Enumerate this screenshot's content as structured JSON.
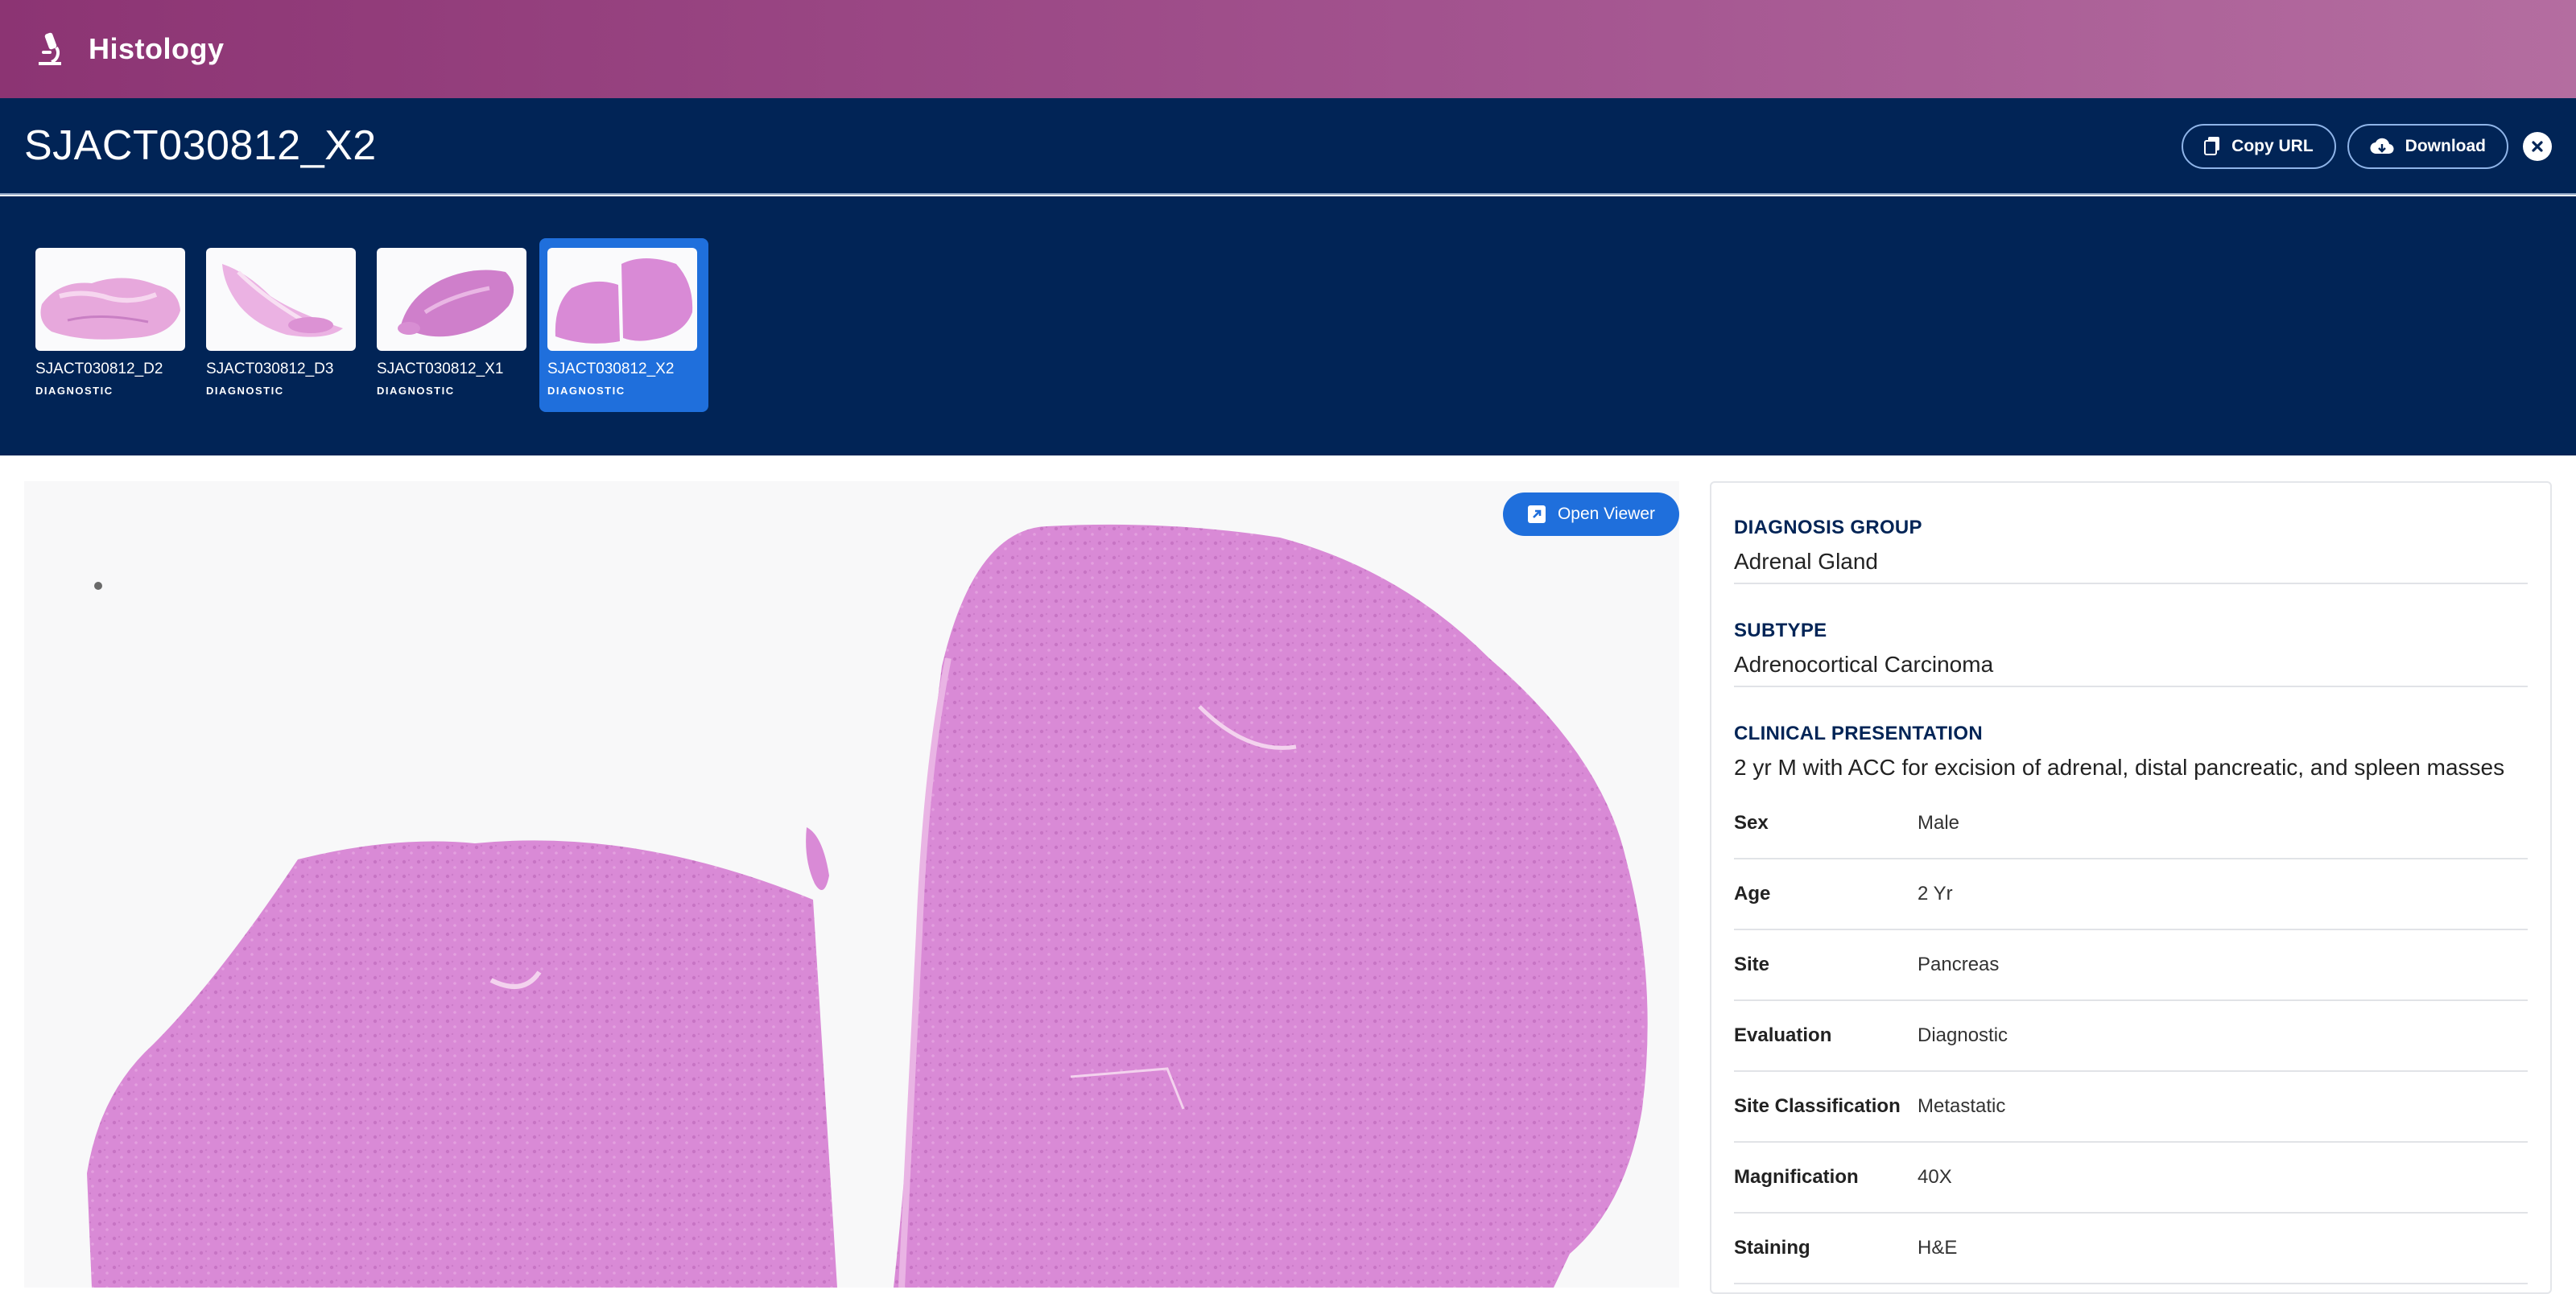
{
  "app": {
    "title": "Histology",
    "icon": "microscope-icon"
  },
  "slide": {
    "title": "SJACT030812_X2",
    "actions": {
      "copy_url": "Copy URL",
      "download": "Download"
    }
  },
  "thumbnails": [
    {
      "name": "SJACT030812_D2",
      "tag": "DIAGNOSTIC",
      "selected": false
    },
    {
      "name": "SJACT030812_D3",
      "tag": "DIAGNOSTIC",
      "selected": false
    },
    {
      "name": "SJACT030812_X1",
      "tag": "DIAGNOSTIC",
      "selected": false
    },
    {
      "name": "SJACT030812_X2",
      "tag": "DIAGNOSTIC",
      "selected": true
    }
  ],
  "viewer": {
    "open_label": "Open Viewer"
  },
  "details": {
    "diagnosis_group": {
      "label": "DIAGNOSIS GROUP",
      "value": "Adrenal Gland"
    },
    "subtype": {
      "label": "SUBTYPE",
      "value": "Adrenocortical Carcinoma"
    },
    "clinical": {
      "label": "CLINICAL PRESENTATION",
      "value": "2 yr M with ACC for excision of adrenal, distal pancreatic, and spleen masses"
    },
    "fields": [
      {
        "key": "Sex",
        "value": "Male"
      },
      {
        "key": "Age",
        "value": "2 Yr"
      },
      {
        "key": "Site",
        "value": "Pancreas"
      },
      {
        "key": "Evaluation",
        "value": "Diagnostic"
      },
      {
        "key": "Site Classification",
        "value": "Metastatic"
      },
      {
        "key": "Magnification",
        "value": "40X"
      },
      {
        "key": "Staining",
        "value": "H&E"
      }
    ]
  },
  "colors": {
    "brand_gradient_start": "#8c3473",
    "header_bg": "#012456",
    "accent": "#1f6fdc",
    "tissue": "#d98ad6"
  }
}
